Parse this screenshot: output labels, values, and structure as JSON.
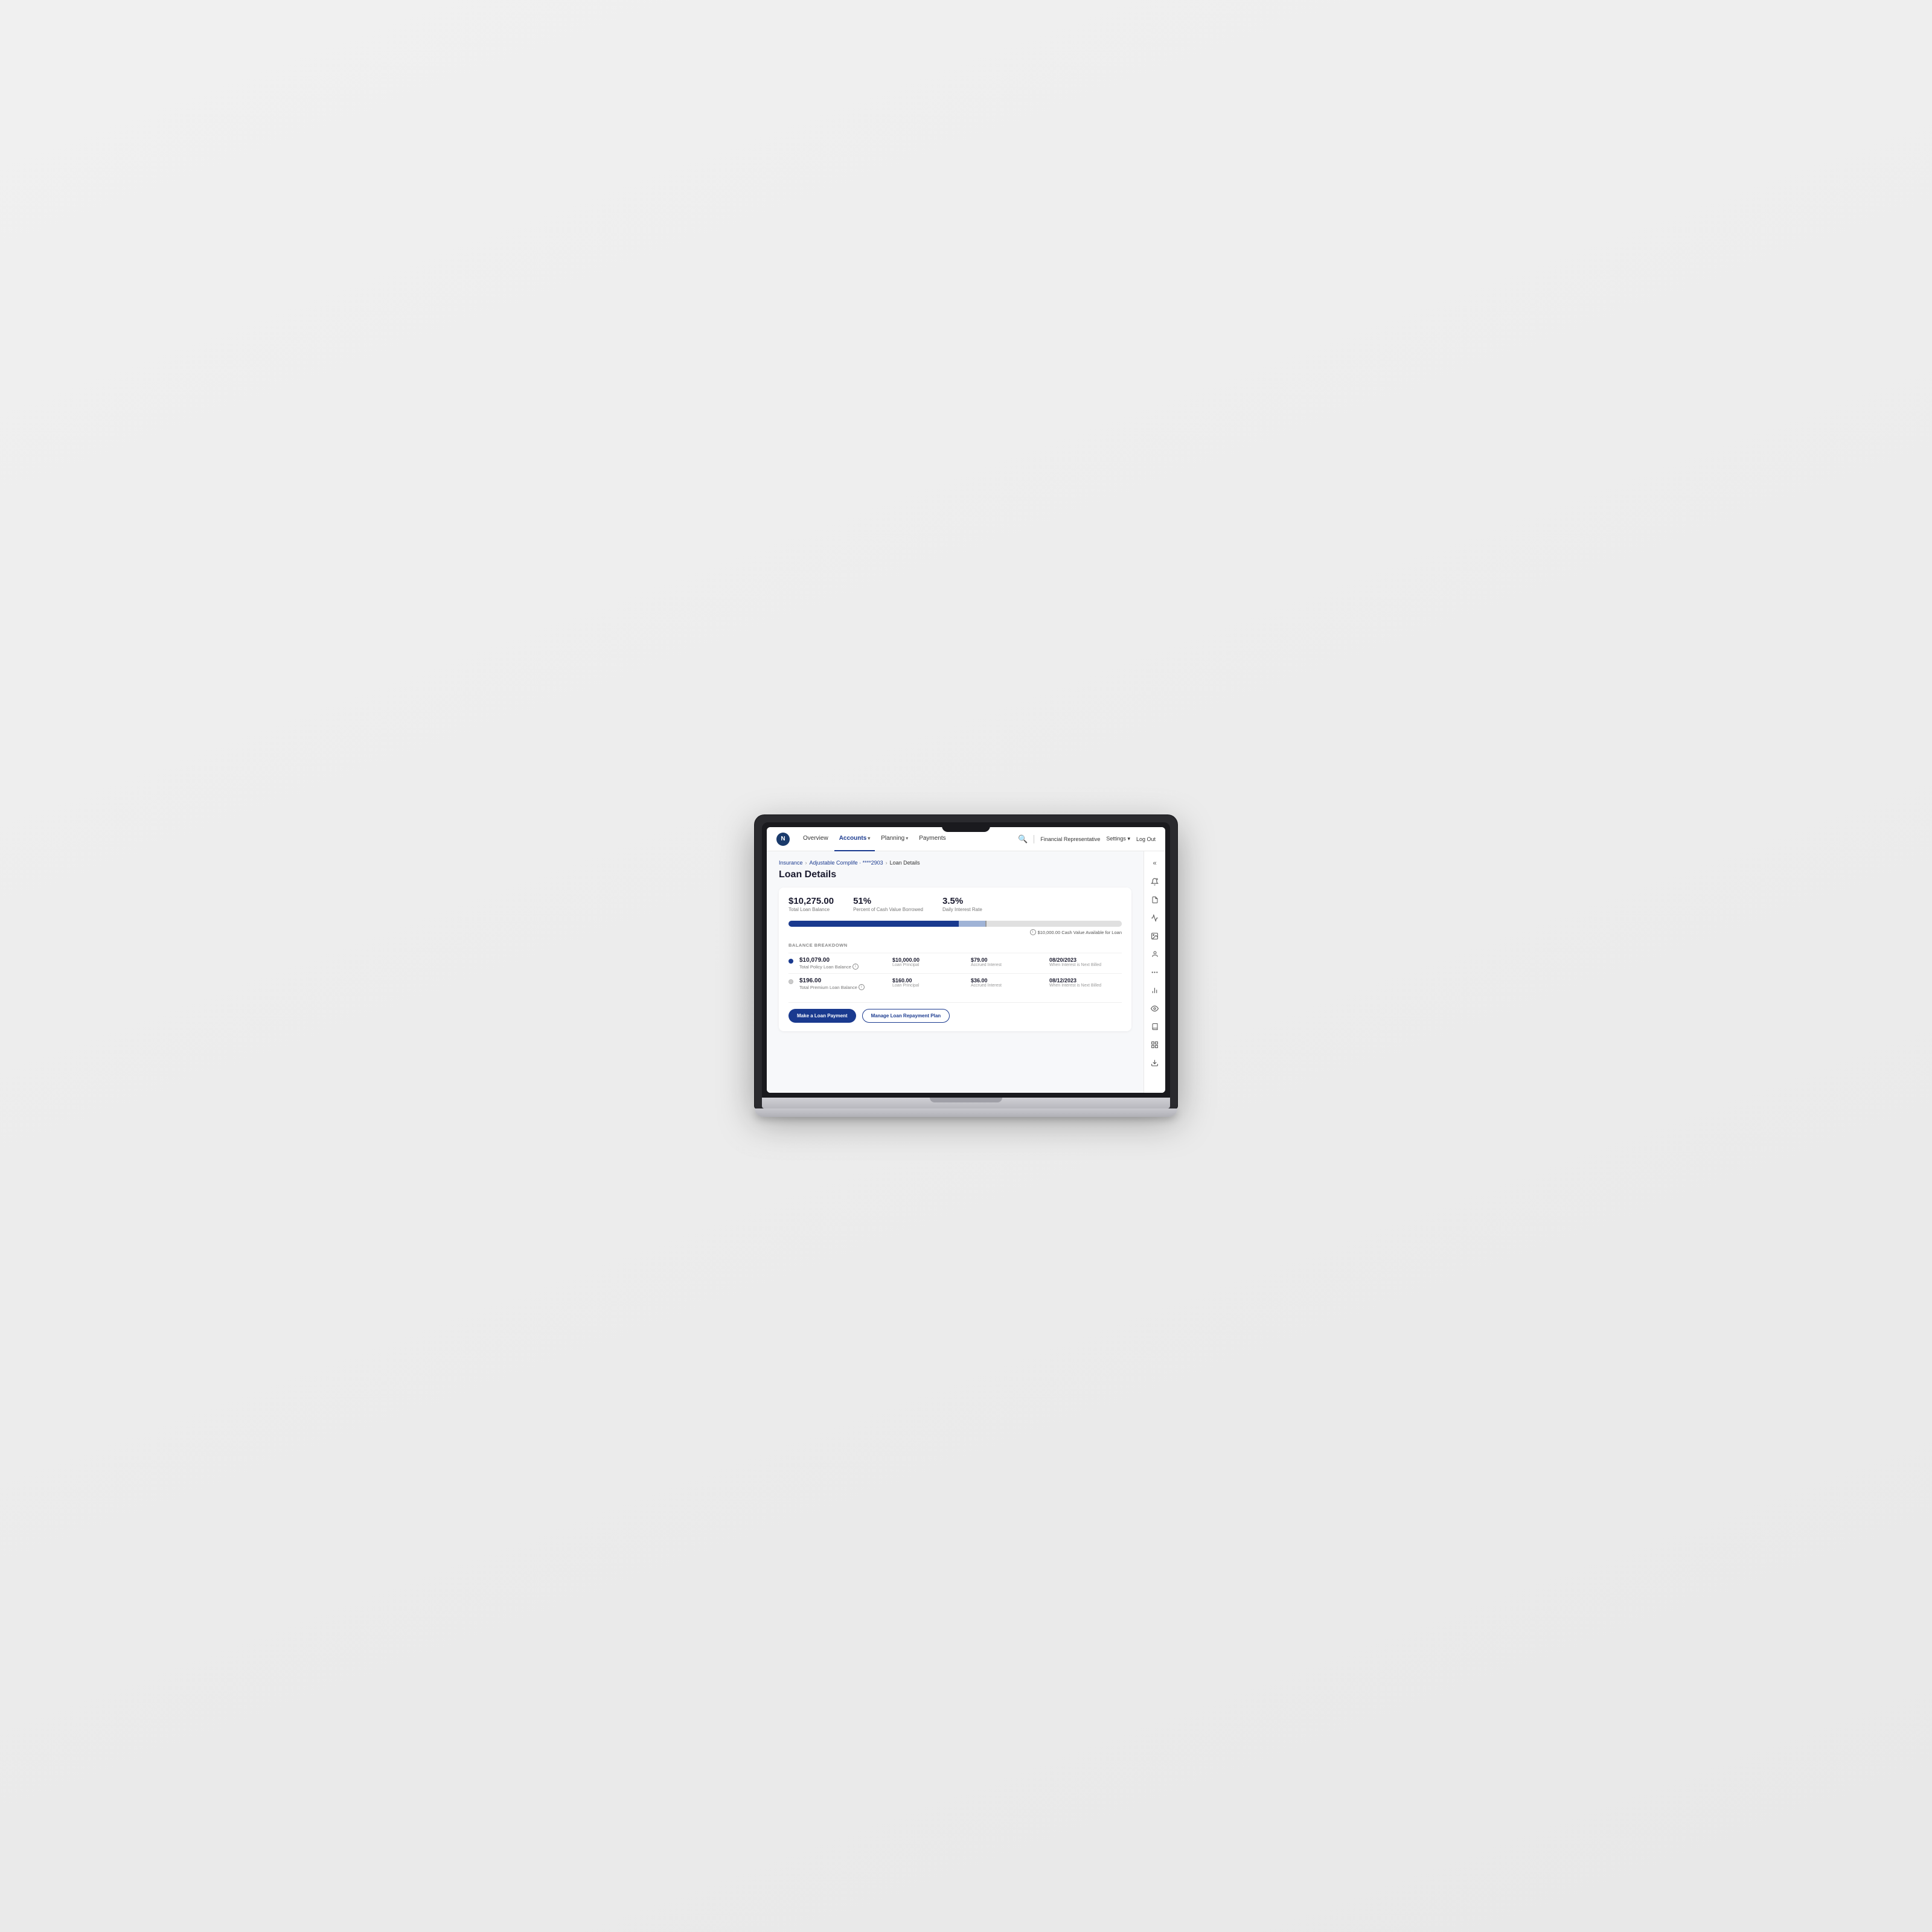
{
  "laptop": {
    "nav": {
      "logo_text": "N",
      "items": [
        {
          "label": "Overview",
          "active": false,
          "has_dropdown": false
        },
        {
          "label": "Accounts",
          "active": true,
          "has_dropdown": true
        },
        {
          "label": "Planning",
          "active": false,
          "has_dropdown": true
        },
        {
          "label": "Payments",
          "active": false,
          "has_dropdown": false
        }
      ],
      "search_icon": "🔍",
      "financial_rep": "Financial Representative",
      "settings": "Settings",
      "settings_has_dropdown": true,
      "logout": "Log Out"
    },
    "breadcrumb": {
      "items": [
        "Insurance",
        "Adjustable Complife · ****2903"
      ],
      "current": "Loan Details"
    },
    "page_title": "Loan Details",
    "stats": {
      "total_loan_balance": {
        "value": "$10,275.00",
        "label": "Total Loan Balance"
      },
      "percent_borrowed": {
        "value": "51%",
        "label": "Percent of Cash Value Borrowed"
      },
      "daily_interest_rate": {
        "value": "3.5%",
        "label": "Daily Interest Rate"
      }
    },
    "progress_bar": {
      "fill_percent": 51,
      "mid_percent": 8,
      "note": "$10,000.00 Cash Value Available for Loan"
    },
    "balance_breakdown": {
      "section_label": "BALANCE BREAKDOWN",
      "rows": [
        {
          "dot": "blue",
          "amount": "$10,079.00",
          "name": "Total Policy Loan Balance",
          "has_info": true,
          "principal": "$10,000.00",
          "principal_label": "Loan Principal",
          "accrued": "$79.00",
          "accrued_label": "Accrued Interest",
          "date": "08/20/2023",
          "date_label": "When Interest is Next Billed"
        },
        {
          "dot": "gray",
          "amount": "$196.00",
          "name": "Total Premium Loan Balance",
          "has_info": true,
          "principal": "$160.00",
          "principal_label": "Loan Principal",
          "accrued": "$36.00",
          "accrued_label": "Accrued Interest",
          "date": "08/12/2023",
          "date_label": "When Interest is Next Billed"
        }
      ]
    },
    "buttons": {
      "primary": "Make a Loan Payment",
      "outline": "Manage Loan Repayment Plan"
    },
    "sidebar_icons": [
      {
        "name": "collapse",
        "symbol": "«"
      },
      {
        "name": "notification",
        "symbol": "🔔"
      },
      {
        "name": "document",
        "symbol": "📄"
      },
      {
        "name": "chart",
        "symbol": "📈"
      },
      {
        "name": "image",
        "symbol": "🖼"
      },
      {
        "name": "person",
        "symbol": "👤"
      },
      {
        "name": "dots",
        "symbol": "⋯"
      },
      {
        "name": "bar-chart",
        "symbol": "📊"
      },
      {
        "name": "eye",
        "symbol": "👁"
      },
      {
        "name": "book",
        "symbol": "📖"
      },
      {
        "name": "grid",
        "symbol": "⊞"
      },
      {
        "name": "download",
        "symbol": "⬇"
      }
    ]
  }
}
